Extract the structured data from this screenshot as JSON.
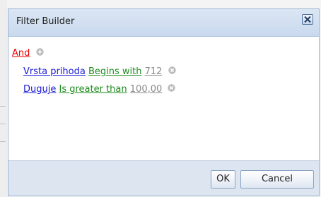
{
  "dialog": {
    "title": "Filter Builder",
    "close_icon": "close-icon"
  },
  "filter": {
    "group_operator": "And",
    "add_icon": "plus-circle-icon",
    "conditions": [
      {
        "field": "Vrsta prihoda",
        "operator": "Begins with",
        "value": "712",
        "remove_icon": "remove-circle-icon"
      },
      {
        "field": "Duguje",
        "operator": "Is greater than",
        "value": "100,00",
        "remove_icon": "remove-circle-icon"
      }
    ]
  },
  "footer": {
    "ok_label": "OK",
    "cancel_label": "Cancel"
  },
  "colors": {
    "group_operator": "#e60000",
    "field": "#1a1ad6",
    "operator": "#1e8b1e",
    "value": "#8a8a8a"
  }
}
